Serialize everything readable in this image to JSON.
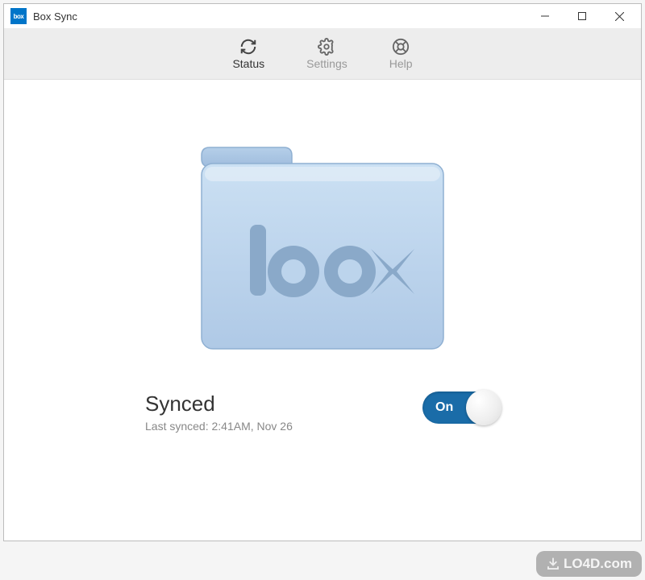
{
  "window": {
    "title": "Box Sync",
    "app_icon_text": "box"
  },
  "toolbar": {
    "tabs": {
      "status": {
        "label": "Status"
      },
      "settings": {
        "label": "Settings"
      },
      "help": {
        "label": "Help"
      }
    }
  },
  "status": {
    "title": "Synced",
    "last_synced_label": "Last synced: 2:41AM, Nov 26",
    "toggle": {
      "label": "On",
      "state": "on"
    }
  },
  "folder_logo_text": "box",
  "watermark": {
    "text": "LO4D.com"
  }
}
